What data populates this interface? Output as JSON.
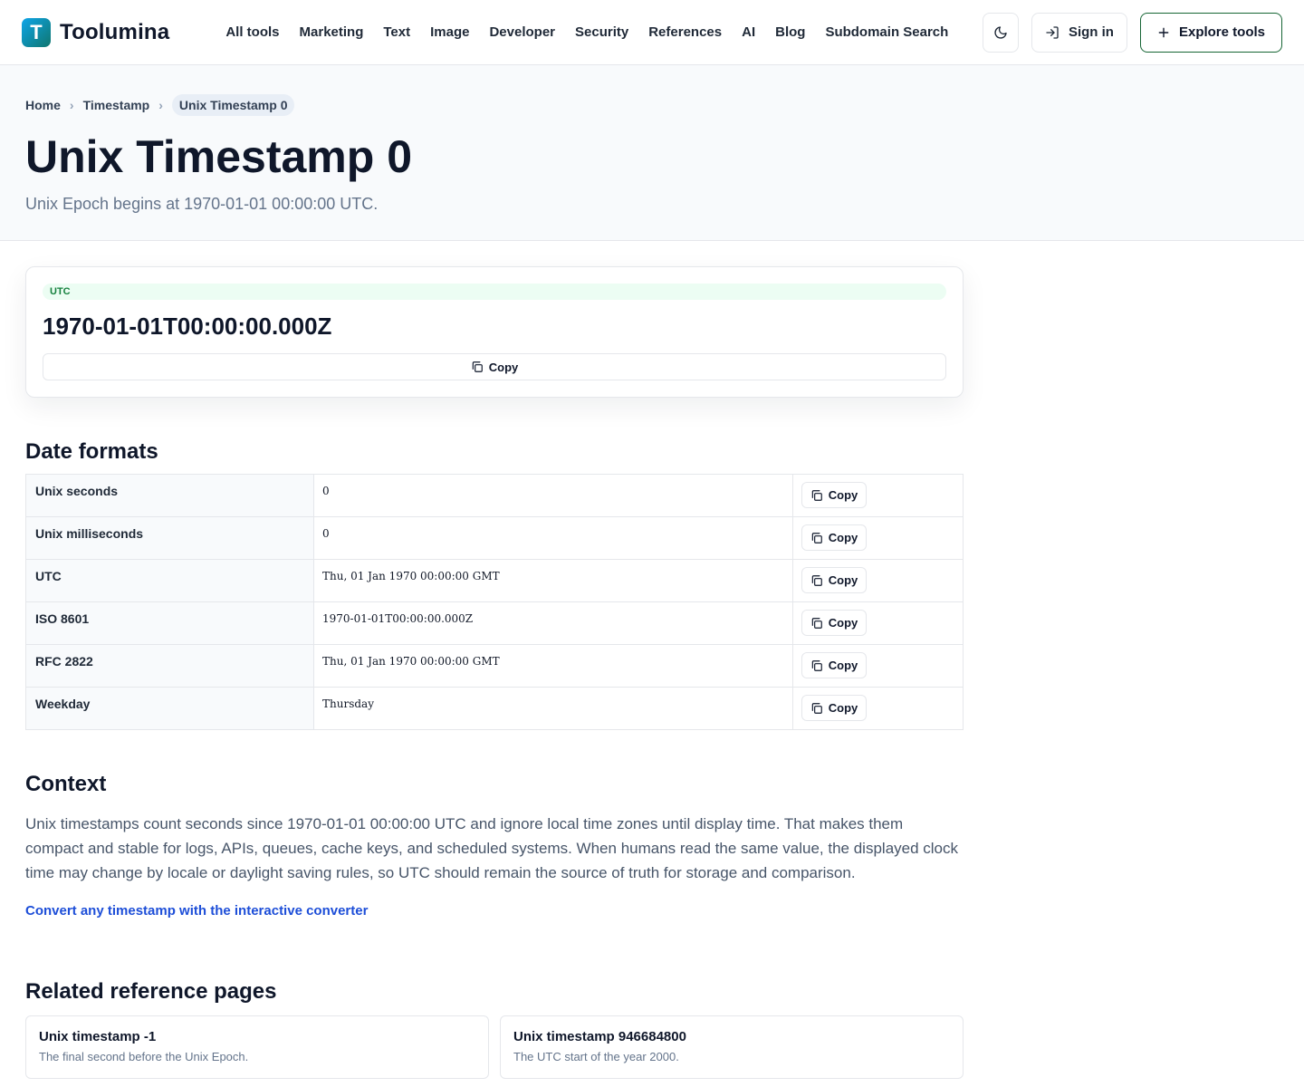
{
  "brand": {
    "logo_letter": "T",
    "name": "Toolumina"
  },
  "nav": [
    "All tools",
    "Marketing",
    "Text",
    "Image",
    "Developer",
    "Security",
    "References",
    "AI",
    "Blog",
    "Subdomain Search"
  ],
  "header": {
    "signin_label": "Sign in",
    "explore_label": "Explore tools"
  },
  "breadcrumb": {
    "home": "Home",
    "section": "Timestamp",
    "current": "Unix Timestamp 0"
  },
  "hero": {
    "title": "Unix Timestamp 0",
    "subtitle": "Unix Epoch begins at 1970-01-01 00:00:00 UTC."
  },
  "utc_card": {
    "badge": "UTC",
    "value": "1970-01-01T00:00:00.000Z",
    "copy_label": "Copy"
  },
  "formats": {
    "title": "Date formats",
    "rows": [
      {
        "label": "Unix seconds",
        "value": "0",
        "copy": "Copy"
      },
      {
        "label": "Unix milliseconds",
        "value": "0",
        "copy": "Copy"
      },
      {
        "label": "UTC",
        "value": "Thu, 01 Jan 1970 00:00:00 GMT",
        "copy": "Copy"
      },
      {
        "label": "ISO 8601",
        "value": "1970-01-01T00:00:00.000Z",
        "copy": "Copy"
      },
      {
        "label": "RFC 2822",
        "value": "Thu, 01 Jan 1970 00:00:00 GMT",
        "copy": "Copy"
      },
      {
        "label": "Weekday",
        "value": "Thursday",
        "copy": "Copy"
      }
    ]
  },
  "context": {
    "title": "Context",
    "text": "Unix timestamps count seconds since 1970-01-01 00:00:00 UTC and ignore local time zones until display time. That makes them compact and stable for logs, APIs, queues, cache keys, and scheduled systems. When humans read the same value, the displayed clock time may change by locale or daylight saving rules, so UTC should remain the source of truth for storage and comparison.",
    "link": "Convert any timestamp with the interactive converter"
  },
  "related": {
    "title": "Related reference pages",
    "cards": [
      {
        "title": "Unix timestamp -1",
        "desc": "The final second before the Unix Epoch."
      },
      {
        "title": "Unix timestamp 946684800",
        "desc": "The UTC start of the year 2000."
      }
    ]
  }
}
